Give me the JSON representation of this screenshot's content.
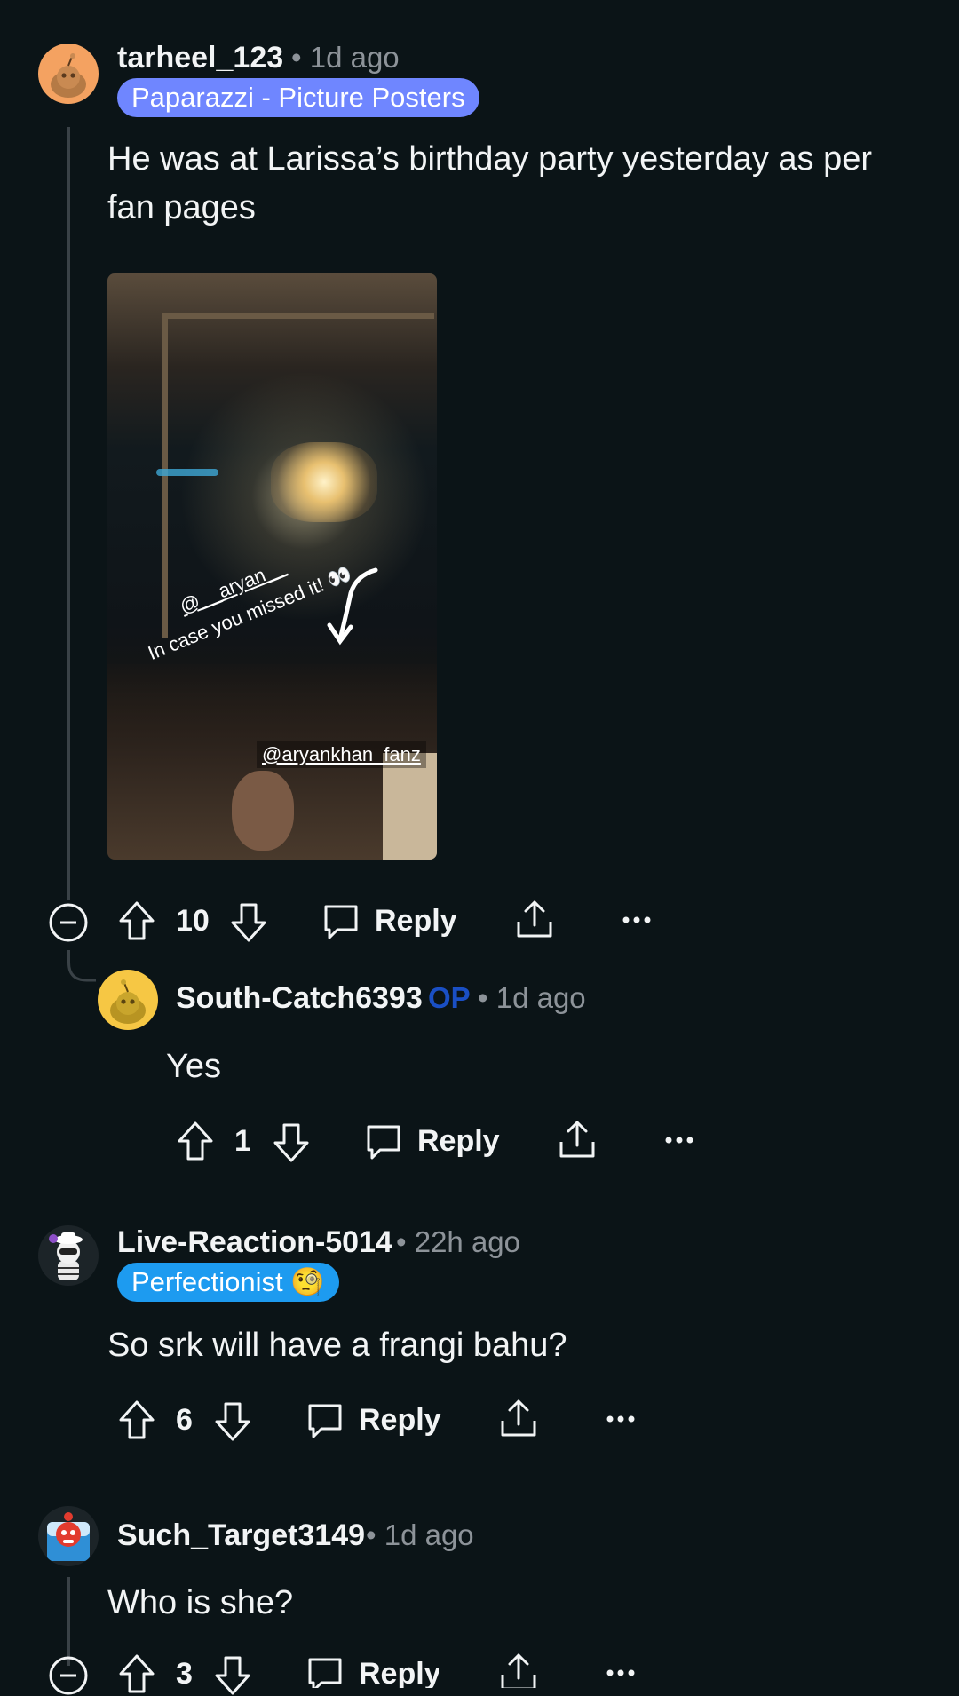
{
  "comments": [
    {
      "username": "tarheel_123",
      "time": "• 1d ago",
      "flair": "Paparazzi - Picture Posters",
      "flair_color": "#6f86ff",
      "text": "He was at Larissa’s birthday party yesterday as per fan pages",
      "image": {
        "overlay_mention": "@__aryan__",
        "overlay_caption": "In case you missed it!",
        "overlay_emoji": "👀",
        "watermark": "@aryankhan_fanz"
      },
      "votes": "10",
      "reply_label": "Reply"
    },
    {
      "username": "South-Catch6393",
      "op_badge": "OP",
      "time": "• 1d ago",
      "text": "Yes",
      "votes": "1",
      "reply_label": "Reply"
    },
    {
      "username": "Live-Reaction-5014",
      "time": "• 22h ago",
      "flair": "Perfectionist 🧐",
      "flair_color": "#1d9bf0",
      "text": "So srk will have a frangi bahu?",
      "votes": "6",
      "reply_label": "Reply"
    },
    {
      "username": "Such_Target3149",
      "time": "• 1d ago",
      "text": "Who is she?",
      "votes": "3",
      "reply_label": "Reply"
    }
  ],
  "icons": {
    "upvote": "upvote-arrow-icon",
    "downvote": "downvote-arrow-icon",
    "reply": "speech-bubble-icon",
    "share": "share-icon",
    "more": "more-dots-icon",
    "collapse": "collapse-minus-icon"
  },
  "colors": {
    "background": "#0b1417",
    "op_badge": "#1a4fc4",
    "avatar_orange": "#f4a261",
    "avatar_yellow": "#f6c744"
  }
}
